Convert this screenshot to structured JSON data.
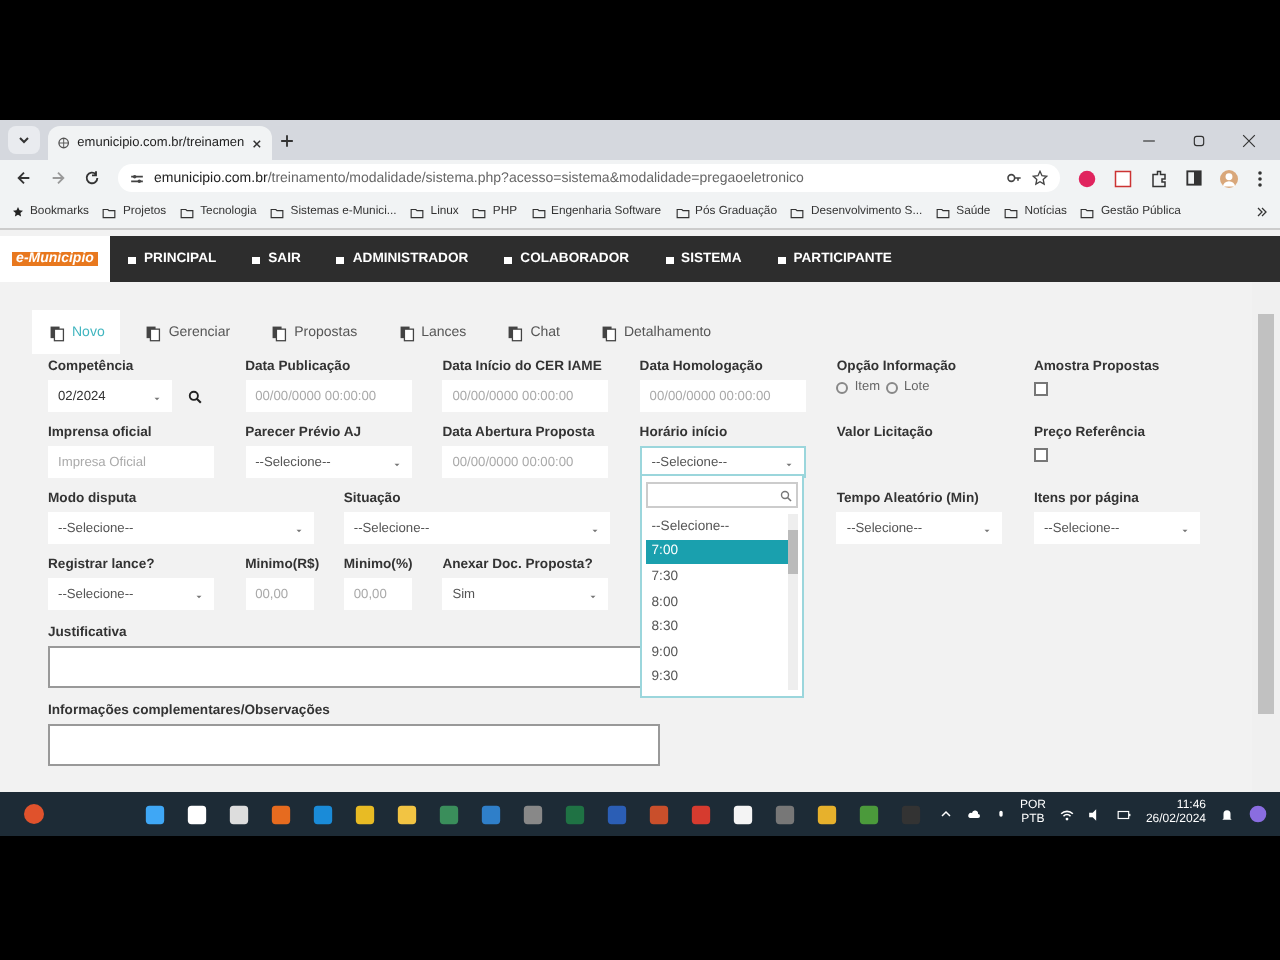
{
  "browser": {
    "tab_title": "emunicipio.com.br/treinamen",
    "url_host": "emunicipio.com.br",
    "url_path": "/treinamento/modalidade/sistema.php?acesso=sistema&modalidade=pregaoeletronico",
    "bookmarks": [
      "Bookmarks",
      "Projetos",
      "Tecnologia",
      "Sistemas e-Munici...",
      "Linux",
      "PHP",
      "Engenharia Software",
      "Pós Graduação",
      "Desenvolvimento S...",
      "Saúde",
      "Notícias",
      "Gestão Pública"
    ]
  },
  "app": {
    "logo": "e-Municipio",
    "nav": [
      "PRINCIPAL",
      "SAIR",
      "ADMINISTRADOR",
      "COLABORADOR",
      "SISTEMA",
      "PARTICIPANTE"
    ],
    "tabs": [
      {
        "label": "Novo",
        "selected": true
      },
      {
        "label": "Gerenciar",
        "selected": false
      },
      {
        "label": "Propostas",
        "selected": false
      },
      {
        "label": "Lances",
        "selected": false
      },
      {
        "label": "Chat",
        "selected": false
      },
      {
        "label": "Detalhamento",
        "selected": false
      }
    ],
    "form_rows": [
      [
        {
          "label": "Competência",
          "kind": "select-search",
          "value": "02/2024"
        },
        {
          "label": "Data Publicação",
          "kind": "text",
          "placeholder": "00/00/0000 00:00:00"
        },
        {
          "label": "Data Início do CER IAME",
          "kind": "text",
          "placeholder": "00/00/0000 00:00:00"
        },
        {
          "label": "Data Homologação",
          "kind": "text",
          "placeholder": "00/00/0000 00:00:00"
        },
        {
          "label": "Opção Informação",
          "kind": "radio",
          "options": [
            {
              "label": "Item",
              "selected": false
            },
            {
              "label": "Lote",
              "selected": false
            }
          ]
        },
        {
          "label": "Amostra Propostas",
          "kind": "checkbox",
          "checked": false
        }
      ],
      [
        {
          "label": "Imprensa oficial",
          "kind": "text",
          "placeholder": "Impresa Oficial"
        },
        {
          "label": "Parecer Prévio AJ",
          "kind": "select",
          "value": "--Selecione--"
        },
        {
          "label": "Data Abertura Proposta",
          "kind": "text",
          "placeholder": "00/00/0000 00:00:00"
        },
        {
          "label": "Horário início",
          "kind": "select-open",
          "value": "--Selecione--"
        },
        {
          "label": "Valor Licitação",
          "kind": "label"
        },
        {
          "label": "Preço Referência",
          "kind": "checkbox",
          "checked": false
        }
      ],
      [
        {
          "label": "Modo disputa",
          "kind": "select",
          "value": "--Selecione--"
        },
        {
          "label": "Situação",
          "kind": "select",
          "value": "--Selecione--"
        },
        {
          "label": "Tempo Aleatório (Min)",
          "kind": "select",
          "value": "--Selecione--"
        },
        {
          "label": "Itens por página",
          "kind": "select",
          "value": "--Selecione--"
        }
      ],
      [
        {
          "label": "Registrar lance?",
          "kind": "select",
          "value": "--Selecione--"
        },
        {
          "label": "Minimo(R$)",
          "kind": "text",
          "placeholder": "00,00"
        },
        {
          "label": "Minimo(%)",
          "kind": "text",
          "placeholder": "00,00"
        },
        {
          "label": "Anexar Doc. Proposta?",
          "kind": "select",
          "value": "Sim"
        }
      ]
    ],
    "textareas": [
      "Justificativa",
      "Informações complementares/Observações"
    ],
    "dropdown": {
      "options": [
        {
          "label": "--Selecione--",
          "selected": false
        },
        {
          "label": "7:00",
          "selected": true
        },
        {
          "label": "7:30",
          "selected": false
        },
        {
          "label": "8:00",
          "selected": false
        },
        {
          "label": "8:30",
          "selected": false
        },
        {
          "label": "9:00",
          "selected": false
        },
        {
          "label": "9:30",
          "selected": false
        }
      ]
    }
  },
  "taskbar": {
    "language": "POR",
    "layout": "PTB",
    "time": "11:46",
    "date": "26/02/2024"
  }
}
